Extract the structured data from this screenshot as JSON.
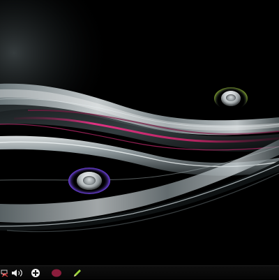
{
  "desktop": {
    "wallpaper_icon": "abstract-waves-wallpaper",
    "accent_colors": {
      "wave_silver": "#c8d3d6",
      "wave_magenta": "#d0307a",
      "button_ring_top": "#b7d14a",
      "button_ring_bottom": "#8a63ff"
    },
    "buttons": [
      {
        "icon": "round-button-icon",
        "ring_color": "#b7d14a"
      },
      {
        "icon": "round-button-icon",
        "ring_color": "#8a63ff"
      }
    ]
  },
  "taskbar": {
    "tray": [
      {
        "icon": "network-icon"
      },
      {
        "icon": "volume-icon"
      },
      {
        "icon": "add-circle-icon"
      },
      {
        "icon": "record-dot-icon",
        "color": "#8b1d3c"
      },
      {
        "icon": "pen-icon",
        "color": "#9bd43a"
      }
    ]
  }
}
